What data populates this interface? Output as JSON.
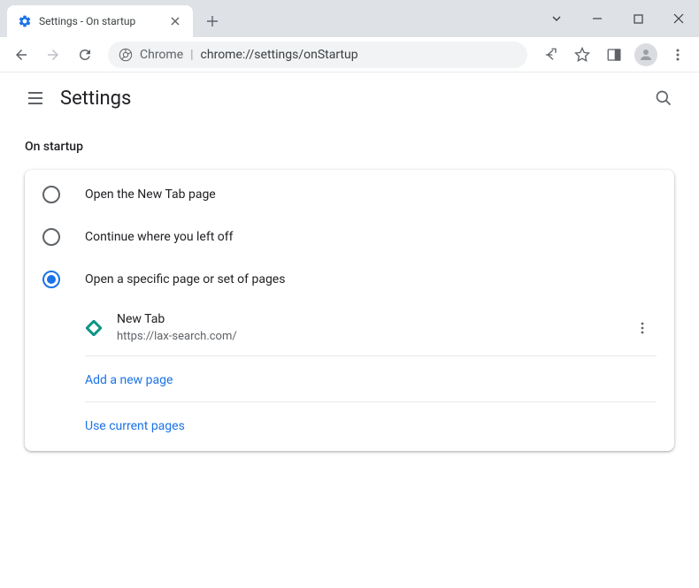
{
  "window": {
    "tab_title": "Settings - On startup"
  },
  "omnibox": {
    "prefix": "Chrome",
    "url": "chrome://settings/onStartup"
  },
  "header": {
    "title": "Settings"
  },
  "section": {
    "title": "On startup"
  },
  "radios": {
    "new_tab": "Open the New Tab page",
    "continue": "Continue where you left off",
    "specific": "Open a specific page or set of pages"
  },
  "startup_page": {
    "title": "New Tab",
    "url": "https://lax-search.com/"
  },
  "actions": {
    "add_page": "Add a new page",
    "use_current": "Use current pages"
  }
}
